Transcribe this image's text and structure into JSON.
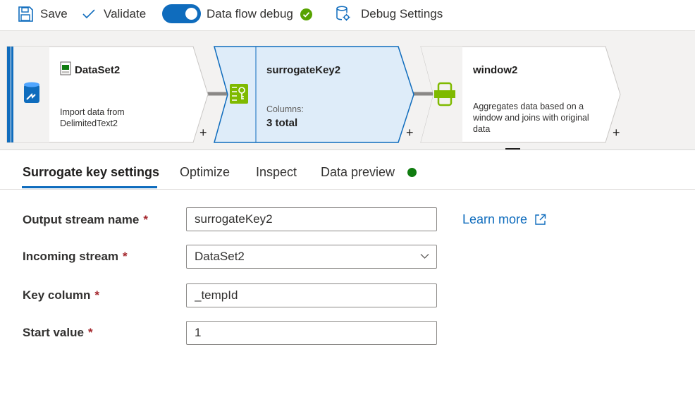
{
  "toolbar": {
    "save": "Save",
    "validate": "Validate",
    "debug_toggle": "Data flow debug",
    "debug_settings": "Debug Settings"
  },
  "nodes": {
    "source": {
      "name": "DataSet2",
      "description_line1": "Import data from",
      "description_line2": "DelimitedText2"
    },
    "surrogate": {
      "name": "surrogateKey2",
      "columns_label": "Columns:",
      "columns_value": "3 total"
    },
    "window": {
      "name": "window2",
      "description_line1": "Aggregates data based on a",
      "description_line2": "window and joins with original",
      "description_line3": "data"
    },
    "plus": "+"
  },
  "tabs": [
    {
      "label": "Surrogate key settings",
      "active": true
    },
    {
      "label": "Optimize",
      "active": false
    },
    {
      "label": "Inspect",
      "active": false
    },
    {
      "label": "Data preview",
      "active": false
    }
  ],
  "form": {
    "required_mark": "*",
    "output_stream": {
      "label": "Output stream name",
      "value": "surrogateKey2"
    },
    "incoming_stream": {
      "label": "Incoming stream",
      "value": "DataSet2"
    },
    "key_column": {
      "label": "Key column",
      "value": "_tempId"
    },
    "start_value": {
      "label": "Start value",
      "value": "1"
    },
    "learn_more": "Learn more"
  },
  "colors": {
    "accent": "#0f6cbd",
    "success": "#107c10",
    "required": "#a4262c",
    "selected_node": "#deecf9",
    "transform_icon": "#7fba00"
  }
}
